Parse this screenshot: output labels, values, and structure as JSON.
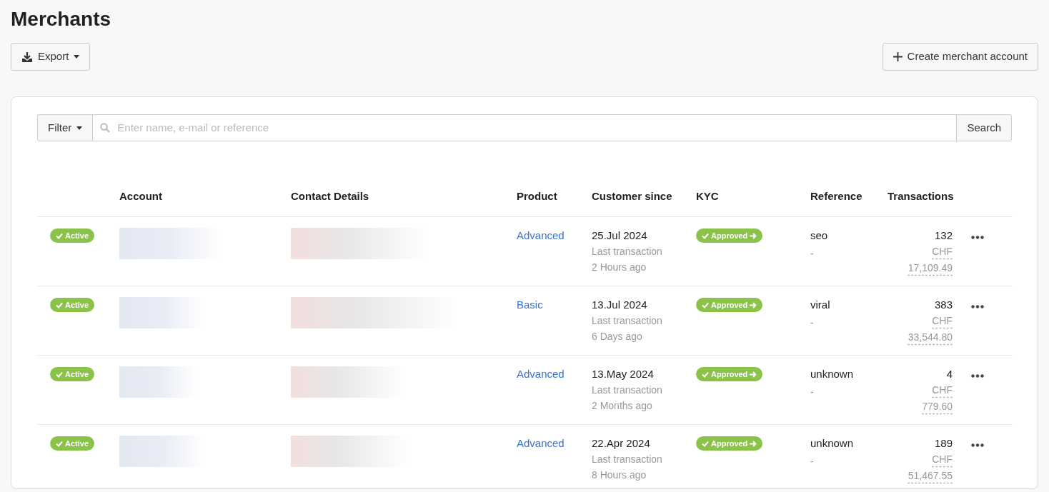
{
  "page": {
    "title": "Merchants"
  },
  "toolbar": {
    "export_button": "Export",
    "create_button": "Create merchant account"
  },
  "search": {
    "filter_button": "Filter",
    "placeholder": "Enter name, e-mail or reference",
    "search_button": "Search"
  },
  "table": {
    "columns": [
      "Account",
      "Contact Details",
      "Product",
      "Customer since",
      "KYC",
      "Reference",
      "Transactions"
    ],
    "rows": [
      {
        "status": "Active",
        "product": "Advanced",
        "since": "25.Jul 2024",
        "last_label": "Last transaction",
        "last_ago": "2 Hours ago",
        "kyc": "Approved",
        "reference": "seo",
        "reference_note": "-",
        "count": "132",
        "amount": "CHF 17,109.49"
      },
      {
        "status": "Active",
        "product": "Basic",
        "since": "13.Jul 2024",
        "last_label": "Last transaction",
        "last_ago": "6 Days ago",
        "kyc": "Approved",
        "reference": "viral",
        "reference_note": "-",
        "count": "383",
        "amount": "CHF 33,544.80"
      },
      {
        "status": "Active",
        "product": "Advanced",
        "since": "13.May 2024",
        "last_label": "Last transaction",
        "last_ago": "2 Months ago",
        "kyc": "Approved",
        "reference": "unknown",
        "reference_note": "-",
        "count": "4",
        "amount": "CHF 779.60"
      },
      {
        "status": "Active",
        "product": "Advanced",
        "since": "22.Apr 2024",
        "last_label": "Last transaction",
        "last_ago": "8 Hours ago",
        "kyc": "Approved",
        "reference": "unknown",
        "reference_note": "-",
        "count": "189",
        "amount": "CHF 51,467.55"
      }
    ]
  }
}
